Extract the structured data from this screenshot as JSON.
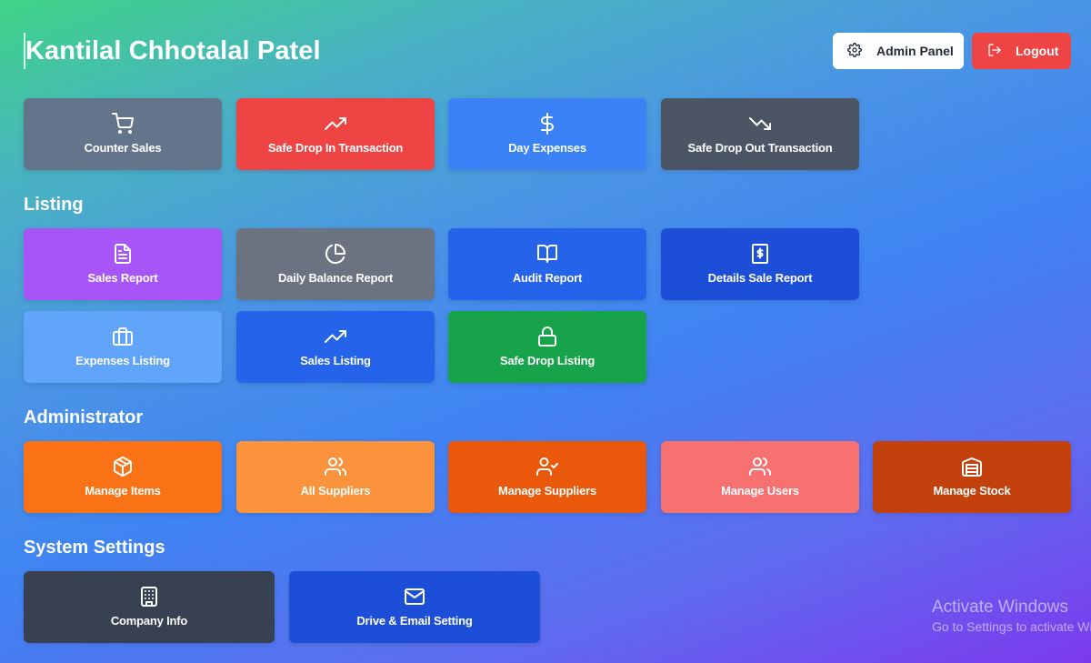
{
  "header": {
    "title": "Kantilal Chhotalal Patel",
    "admin_panel_label": "Admin Panel",
    "logout_label": "Logout"
  },
  "quick_actions": [
    {
      "label": "Counter Sales",
      "icon": "cart-icon",
      "color": "#64748b"
    },
    {
      "label": "Safe Drop In Transaction",
      "icon": "trending-up-icon",
      "color": "#ef4444"
    },
    {
      "label": "Day Expenses",
      "icon": "dollar-icon",
      "color": "#3b82f6"
    },
    {
      "label": "Safe Drop Out Transaction",
      "icon": "trending-down-icon",
      "color": "#4b5563"
    }
  ],
  "listing": {
    "title": "Listing",
    "items": [
      {
        "label": "Sales Report",
        "icon": "file-text-icon",
        "color": "#a855f7"
      },
      {
        "label": "Daily Balance Report",
        "icon": "pie-chart-icon",
        "color": "#6b7280"
      },
      {
        "label": "Audit Report",
        "icon": "book-open-icon",
        "color": "#2563eb"
      },
      {
        "label": "Details Sale Report",
        "icon": "receipt-icon",
        "color": "#1d4ed8"
      },
      {
        "label": "Expenses Listing",
        "icon": "briefcase-icon",
        "color": "#60a5fa"
      },
      {
        "label": "Sales Listing",
        "icon": "trending-up-icon",
        "color": "#2563eb"
      },
      {
        "label": "Safe Drop Listing",
        "icon": "lock-icon",
        "color": "#16a34a"
      }
    ]
  },
  "administrator": {
    "title": "Administrator",
    "items": [
      {
        "label": "Manage Items",
        "icon": "package-icon",
        "color": "#f97316"
      },
      {
        "label": "All Suppliers",
        "icon": "users-icon",
        "color": "#fb923c"
      },
      {
        "label": "Manage Suppliers",
        "icon": "user-check-icon",
        "color": "#ea580c"
      },
      {
        "label": "Manage Users",
        "icon": "users-icon",
        "color": "#f87171"
      },
      {
        "label": "Manage Stock",
        "icon": "warehouse-icon",
        "color": "#c2410c"
      }
    ]
  },
  "system_settings": {
    "title": "System Settings",
    "items": [
      {
        "label": "Company Info",
        "icon": "building-icon",
        "color": "#374151"
      },
      {
        "label": "Drive & Email Setting",
        "icon": "mail-icon",
        "color": "#1d4ed8"
      }
    ]
  },
  "watermark": {
    "line1": "Activate Windows",
    "line2": "Go to Settings to activate Windows."
  }
}
